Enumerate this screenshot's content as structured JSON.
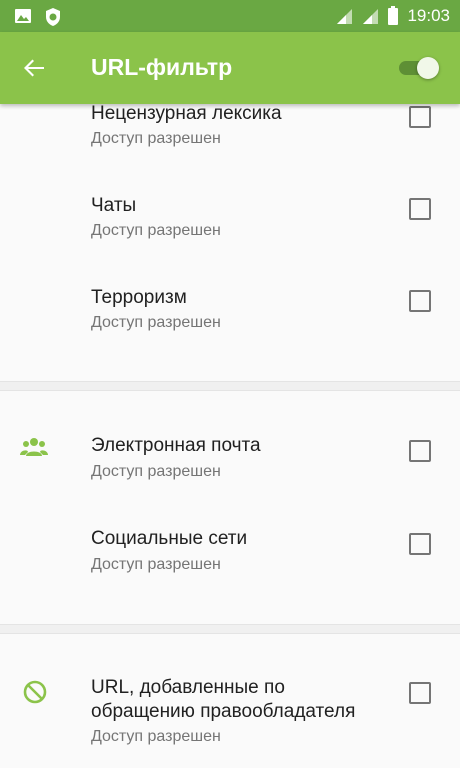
{
  "status_bar": {
    "time": "19:03",
    "icons": [
      "image-icon",
      "shield-app-icon",
      "signal-icon",
      "signal-icon",
      "battery-icon"
    ]
  },
  "app_bar": {
    "title": "URL-фильтр",
    "back_icon": "arrow-back-icon",
    "toggle_on": true
  },
  "groups": [
    {
      "icon": null,
      "items": [
        {
          "name": "Нецензурная лексика",
          "status": "Доступ разрешен",
          "checked": false
        },
        {
          "name": "Чаты",
          "status": "Доступ разрешен",
          "checked": false
        },
        {
          "name": "Терроризм",
          "status": "Доступ разрешен",
          "checked": false
        }
      ]
    },
    {
      "icon": "people-icon",
      "items": [
        {
          "name": "Электронная почта",
          "status": "Доступ разрешен",
          "checked": false
        },
        {
          "name": "Социальные сети",
          "status": "Доступ разрешен",
          "checked": false
        }
      ]
    },
    {
      "icon": "block-icon",
      "items": [
        {
          "name_line1": "URL, добавленные по",
          "name_line2": "обращению правообладателя",
          "status": "Доступ разрешен",
          "checked": false
        }
      ]
    }
  ],
  "colors": {
    "status_bar": "#6aa843",
    "app_bar": "#8bc34a",
    "icon_green": "#8bc34a"
  }
}
